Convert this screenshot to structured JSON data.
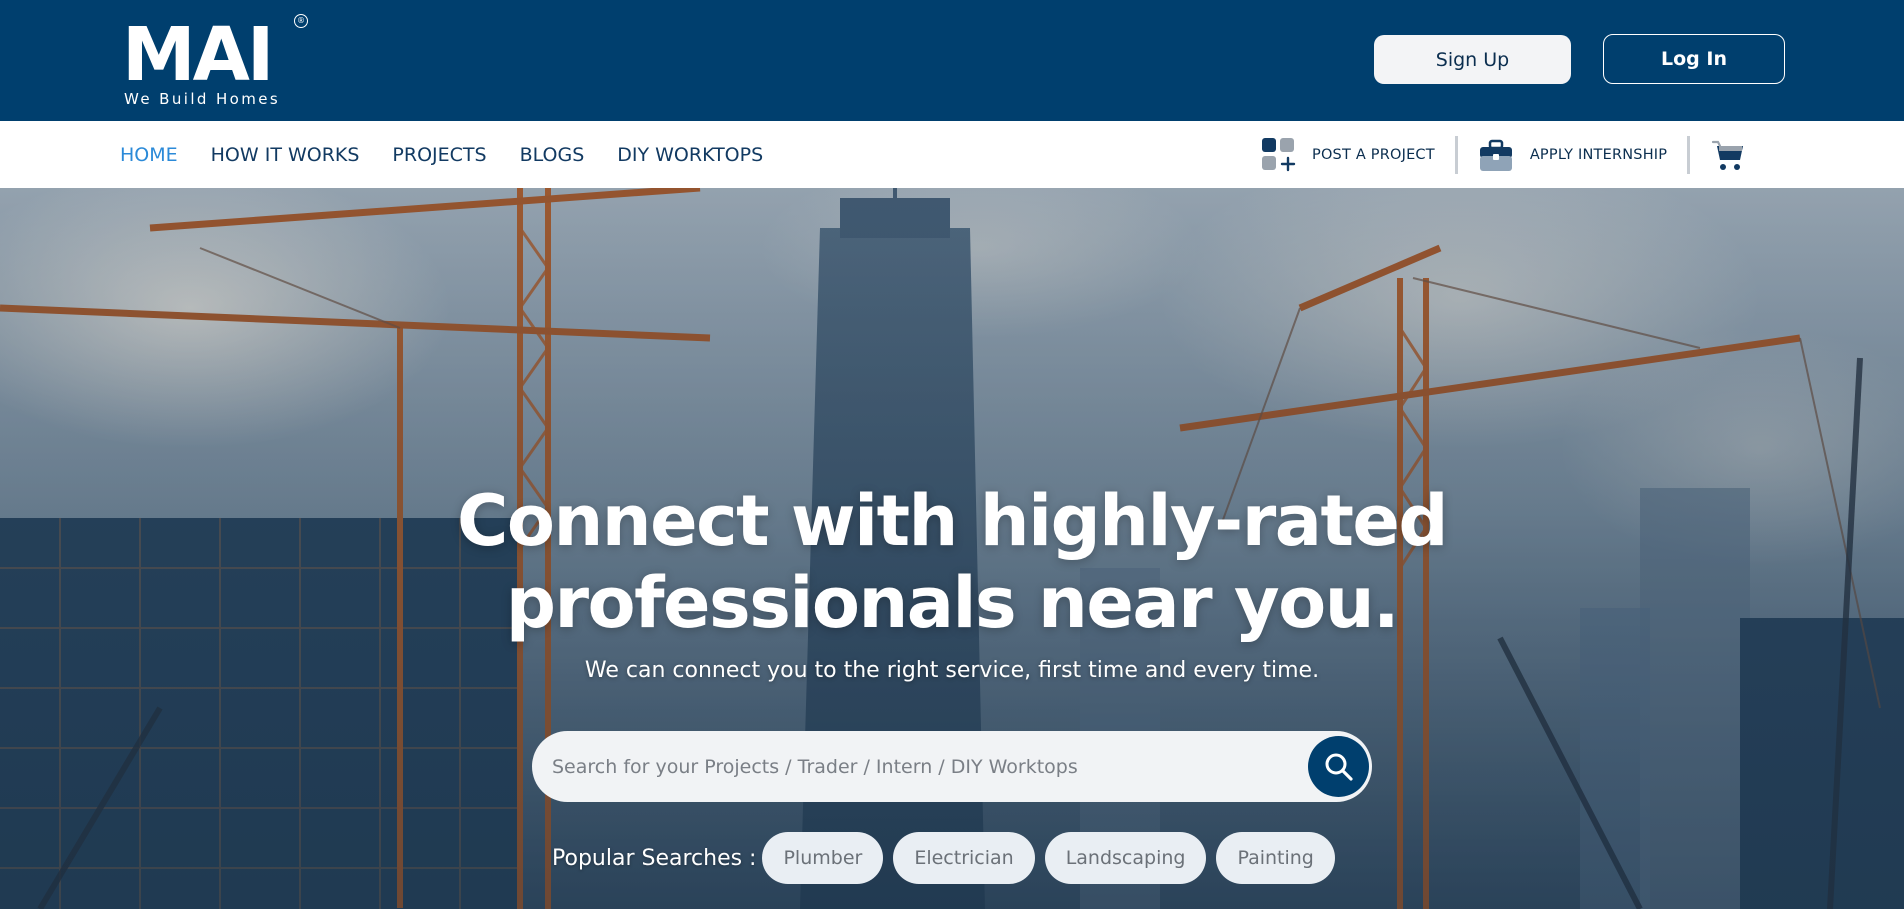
{
  "brand": {
    "logo_text": "MAI",
    "registered_mark": "®",
    "tagline": "We Build Homes"
  },
  "header": {
    "signup_label": "Sign Up",
    "login_label": "Log In"
  },
  "nav": {
    "links": [
      {
        "label": "HOME",
        "active": true
      },
      {
        "label": "HOW IT WORKS"
      },
      {
        "label": "PROJECTS"
      },
      {
        "label": "BLOGS"
      },
      {
        "label": "DIY WORKTOPS"
      }
    ],
    "actions": {
      "post_project": "POST A PROJECT",
      "apply_internship": "APPLY INTERNSHIP"
    }
  },
  "hero": {
    "title_line1": "Connect with highly-rated",
    "title_line2": "professionals near you.",
    "subtitle": "We can connect you to the right service, first time and every time.",
    "search": {
      "placeholder": "Search for your Projects / Trader / Intern / DIY Worktops"
    },
    "popular": {
      "label": "Popular Searches :",
      "chips": [
        "Plumber",
        "Electrician",
        "Landscaping",
        "Painting"
      ]
    }
  },
  "colors": {
    "brand_navy": "#003f6e",
    "nav_active": "#2b8ad8",
    "nav_text": "#123a62",
    "crane_orange": "#c0652a"
  },
  "icons": {
    "post_project": "grid-plus-icon",
    "apply_internship": "briefcase-icon",
    "cart": "cart-icon",
    "search": "search-icon"
  }
}
